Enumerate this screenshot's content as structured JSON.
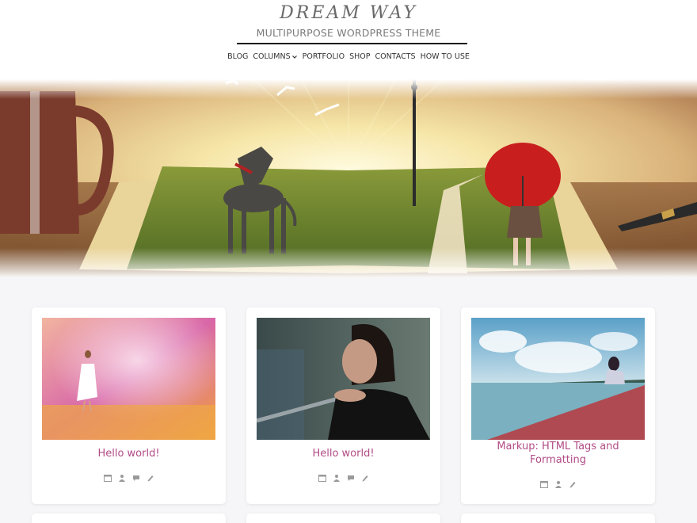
{
  "site": {
    "logo": "DREAM WAY",
    "tagline": "MULTIPURPOSE WORDPRESS THEME"
  },
  "nav": {
    "items": [
      "BLOG",
      "COLUMNS",
      "PORTFOLIO",
      "SHOP",
      "CONTACTS",
      "HOW TO USE"
    ],
    "dropdown_item": "COLUMNS"
  },
  "hero": {
    "image": "open-book-landscape-with-dog-and-girl-with-red-umbrella"
  },
  "posts": [
    {
      "title": "Hello world!",
      "image": "woman-in-white-dress-on-shore",
      "meta_icons": [
        "calendar-icon",
        "author-icon",
        "comment-icon",
        "edit-icon"
      ]
    },
    {
      "title": "Hello world!",
      "image": "thoughtful-woman-leaning-on-railing",
      "meta_icons": [
        "calendar-icon",
        "author-icon",
        "comment-icon",
        "edit-icon"
      ]
    },
    {
      "title": "Markup: HTML Tags and Formatting",
      "image": "girl-sitting-on-pier-by-sea",
      "meta_icons": [
        "calendar-icon",
        "author-icon",
        "edit-icon"
      ]
    }
  ],
  "colors": {
    "title_pink": "#b24c86",
    "background": "#f6f6f8",
    "meta_icon": "#9a9a9a"
  }
}
